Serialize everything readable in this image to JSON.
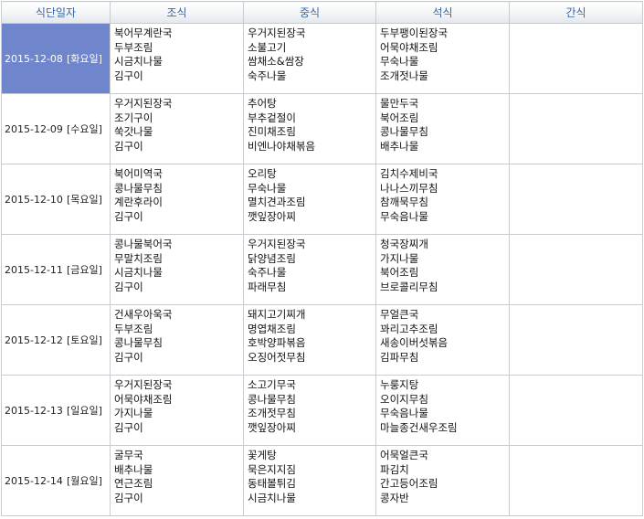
{
  "header": {
    "date": "식단일자",
    "breakfast": "조식",
    "lunch": "중식",
    "dinner": "석식",
    "snack": "간식"
  },
  "selected_row": 0,
  "rows": [
    {
      "date": "2015-12-08",
      "weekday": "[화요일]",
      "breakfast": [
        "북어무계란국",
        "두부조림",
        "시금치나물",
        "김구이"
      ],
      "lunch": [
        "우거지된장국",
        "소불고기",
        "쌈채소&쌈장",
        "숙주나물"
      ],
      "dinner": [
        "두부팽이된장국",
        "어묵야채조림",
        "무숙나물",
        "조개젓나물"
      ],
      "snack": []
    },
    {
      "date": "2015-12-09",
      "weekday": "[수요일]",
      "breakfast": [
        "우거지된장국",
        "조기구이",
        "쑥갓나물",
        "김구이"
      ],
      "lunch": [
        "추어탕",
        "부추겉절이",
        "진미채조림",
        "비엔나야채볶음"
      ],
      "dinner": [
        "물만두국",
        "북어조림",
        "콩나물무침",
        "배추나물"
      ],
      "snack": []
    },
    {
      "date": "2015-12-10",
      "weekday": "[목요일]",
      "breakfast": [
        "북어미역국",
        "콩나물무침",
        "계란후라이",
        "김구이"
      ],
      "lunch": [
        "오리탕",
        "무숙나물",
        "멸치견과조림",
        "깻잎장아찌"
      ],
      "dinner": [
        "김치수제비국",
        "나나스끼무침",
        "참깨묵무침",
        "무숙음나물"
      ],
      "snack": []
    },
    {
      "date": "2015-12-11",
      "weekday": "[금요일]",
      "breakfast": [
        "콩나물북어국",
        "무말치조림",
        "시금치나물",
        "김구이"
      ],
      "lunch": [
        "우거지된장국",
        "닭양념조림",
        "숙주나물",
        "파래무침"
      ],
      "dinner": [
        "청국장찌개",
        "가지나물",
        "북어조림",
        "브로콜리무침"
      ],
      "snack": []
    },
    {
      "date": "2015-12-12",
      "weekday": "[토요일]",
      "breakfast": [
        "건새우아욱국",
        "두부조림",
        "콩나물무침",
        "김구이"
      ],
      "lunch": [
        "돼지고기찌개",
        "명엽채조림",
        "호박양파볶음",
        "오징어젓무침"
      ],
      "dinner": [
        "무얼큰국",
        "꽈리고추조림",
        "새송이버섯볶음",
        "김파무침"
      ],
      "snack": []
    },
    {
      "date": "2015-12-13",
      "weekday": "[일요일]",
      "breakfast": [
        "우거지된장국",
        "어묵야채조림",
        "가지나물",
        "김구이"
      ],
      "lunch": [
        "소고기무국",
        "콩나물무침",
        "조개젓무침",
        "깻잎장아찌"
      ],
      "dinner": [
        "누룽지탕",
        "오이지무침",
        "무숙음나물",
        "마늘종건새우조림"
      ],
      "snack": []
    },
    {
      "date": "2015-12-14",
      "weekday": "[월요일]",
      "breakfast": [
        "굴무국",
        "배추나물",
        "연근조림",
        "김구이"
      ],
      "lunch": [
        "꽃게탕",
        "묵은지지짐",
        "동태볼튀김",
        "시금치나물"
      ],
      "dinner": [
        "어묵얼큰국",
        "파김치",
        "간고등어조림",
        "콩자반"
      ],
      "snack": []
    }
  ]
}
